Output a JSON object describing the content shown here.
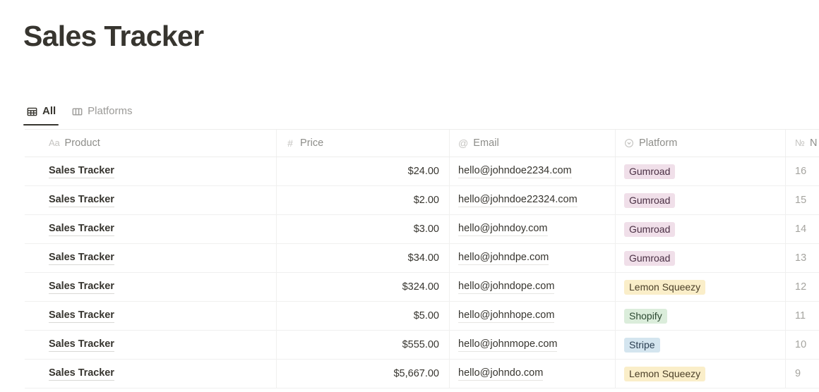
{
  "page": {
    "title": "Sales Tracker"
  },
  "tabs": [
    {
      "label": "All",
      "icon": "table-grid-icon",
      "active": true
    },
    {
      "label": "Platforms",
      "icon": "board-columns-icon",
      "active": false
    }
  ],
  "table": {
    "columns": [
      {
        "key": "product",
        "label": "Product",
        "icon": "Aa",
        "icon_name": "text-type-icon"
      },
      {
        "key": "price",
        "label": "Price",
        "icon": "#",
        "icon_name": "number-type-icon"
      },
      {
        "key": "email",
        "label": "Email",
        "icon": "@",
        "icon_name": "email-type-icon"
      },
      {
        "key": "platform",
        "label": "Platform",
        "icon": "",
        "icon_name": "select-type-icon"
      },
      {
        "key": "number",
        "label": "N",
        "icon": "№",
        "icon_name": "number-id-type-icon"
      }
    ],
    "rows": [
      {
        "product": "Sales Tracker",
        "price": "$24.00",
        "email": "hello@johndoe2234.com",
        "platform": "Gumroad",
        "number": "16"
      },
      {
        "product": "Sales Tracker",
        "price": "$2.00",
        "email": "hello@johndoe22324.com",
        "platform": "Gumroad",
        "number": "15"
      },
      {
        "product": "Sales Tracker",
        "price": "$3.00",
        "email": "hello@johndoy.com",
        "platform": "Gumroad",
        "number": "14"
      },
      {
        "product": "Sales Tracker",
        "price": "$34.00",
        "email": "hello@johndpe.com",
        "platform": "Gumroad",
        "number": "13"
      },
      {
        "product": "Sales Tracker",
        "price": "$324.00",
        "email": "hello@johndope.com",
        "platform": "Lemon Squeezy",
        "number": "12"
      },
      {
        "product": "Sales Tracker",
        "price": "$5.00",
        "email": "hello@johnhope.com",
        "platform": "Shopify",
        "number": "11"
      },
      {
        "product": "Sales Tracker",
        "price": "$555.00",
        "email": "hello@johnmope.com",
        "platform": "Stripe",
        "number": "10"
      },
      {
        "product": "Sales Tracker",
        "price": "$5,667.00",
        "email": "hello@johndo.com",
        "platform": "Lemon Squeezy",
        "number": "9"
      }
    ]
  },
  "tag_colors": {
    "Gumroad": {
      "bg": "#f0dfe9",
      "fg": "#4a3044"
    },
    "Lemon Squeezy": {
      "bg": "#faeec9",
      "fg": "#4b3f28"
    },
    "Shopify": {
      "bg": "#dbeddb",
      "fg": "#2d4a32"
    },
    "Stripe": {
      "bg": "#d4e5ef",
      "fg": "#2b3f52"
    }
  },
  "theme": {
    "text_primary": "#37352f",
    "text_muted": "#91918e",
    "text_faint": "#a5a49f",
    "border": "#f0f0ef",
    "background": "#ffffff",
    "tab_underline": "#37352f"
  }
}
